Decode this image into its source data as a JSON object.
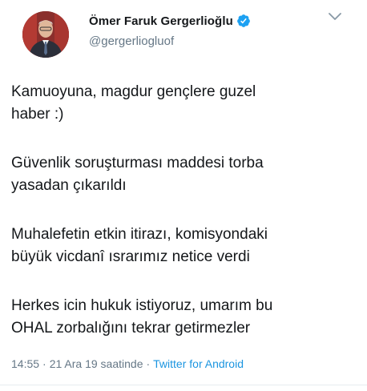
{
  "author": {
    "display_name": "Ömer Faruk Gergerlioğlu",
    "handle": "@gergerliogluof",
    "verified": true
  },
  "tweet": {
    "paragraphs": [
      [
        "Kamuoyuna, magdur gençlere guzel",
        "haber :)"
      ],
      [
        "Güvenlik soruşturması maddesi torba",
        "yasadan çıkarıldı"
      ],
      [
        "Muhalefetin etkin itirazı, komisyondaki",
        "büyük vicdanî ısrarımız netice verdi"
      ],
      [
        "Herkes icin hukuk istiyoruz, umarım bu",
        "OHAL zorbalığını tekrar getirmezler"
      ]
    ],
    "time": "14:55",
    "date": "21 Ara 19 saatinde",
    "separator": "·",
    "source": "Twitter for Android"
  },
  "icons": {
    "verified": "verified-badge-icon",
    "menu": "chevron-down-icon"
  },
  "colors": {
    "text": "#14171a",
    "secondary": "#657786",
    "link": "#1b95e0",
    "verified": "#1da1f2"
  }
}
